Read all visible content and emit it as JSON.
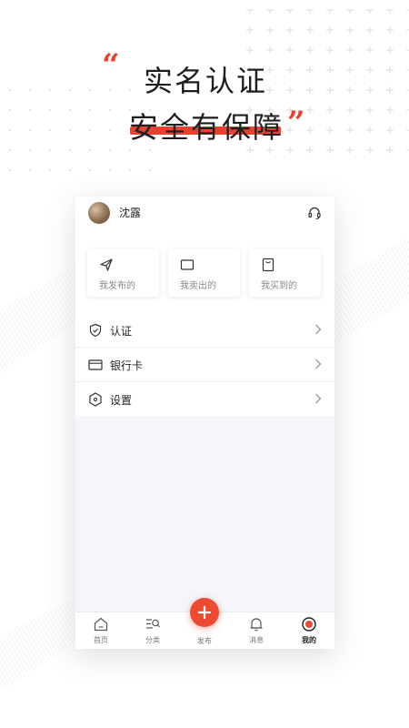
{
  "hero": {
    "quote_open": "“",
    "line1": "实名认证",
    "line2": "安全有保障",
    "quote_close": "”"
  },
  "profile": {
    "username": "沈露",
    "support_icon": "headset-icon"
  },
  "quick_actions": [
    {
      "label": "我发布的",
      "icon": "send-icon"
    },
    {
      "label": "我卖出的",
      "icon": "box-icon"
    },
    {
      "label": "我买到的",
      "icon": "bag-icon"
    }
  ],
  "menu": [
    {
      "label": "认证",
      "icon": "shield-icon"
    },
    {
      "label": "银行卡",
      "icon": "card-icon"
    },
    {
      "label": "设置",
      "icon": "gear-icon"
    }
  ],
  "tabbar": {
    "home": "首页",
    "category": "分类",
    "publish": "发布",
    "messages": "消息",
    "mine": "我的",
    "publish_symbol": "+"
  },
  "colors": {
    "accent": "#ee4a30",
    "background": "#f4f6f9"
  }
}
